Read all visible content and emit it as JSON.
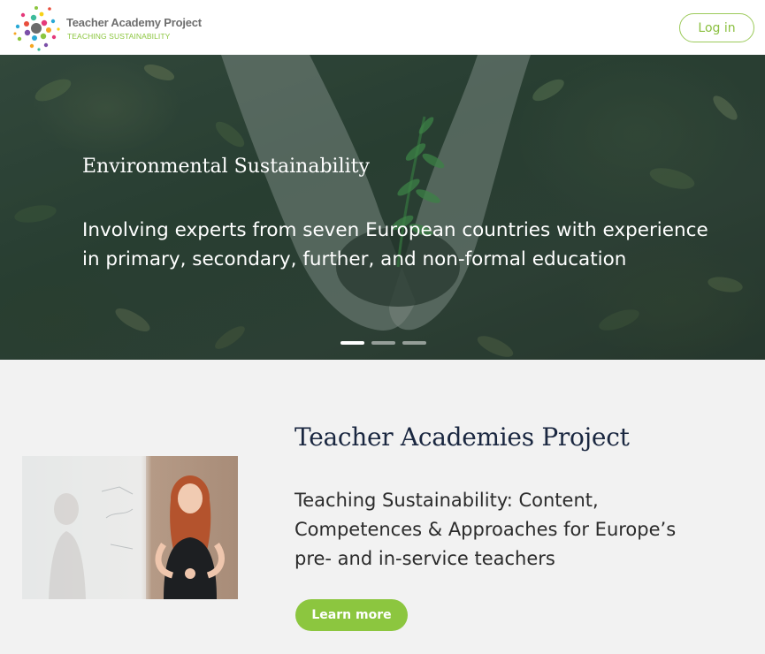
{
  "header": {
    "logo_title": "Teacher Academy Project",
    "logo_subtitle": "TEACHING SUSTAINABILITY",
    "login_label": "Log in"
  },
  "hero": {
    "title": "Environmental Sustainability",
    "text": "Involving experts from seven European countries with experience in primary, secondary, further, and non-formal education",
    "slides": [
      {
        "active": true
      },
      {
        "active": false
      },
      {
        "active": false
      }
    ]
  },
  "main": {
    "title": "Teacher Academies Project",
    "text": "Teaching Sustainability: Content, Competences & Approaches for Europe’s pre- and in-service teachers",
    "learn_more_label": "Learn more"
  },
  "colors": {
    "brand_green": "#8cc63f",
    "title_navy": "#1a2740"
  }
}
